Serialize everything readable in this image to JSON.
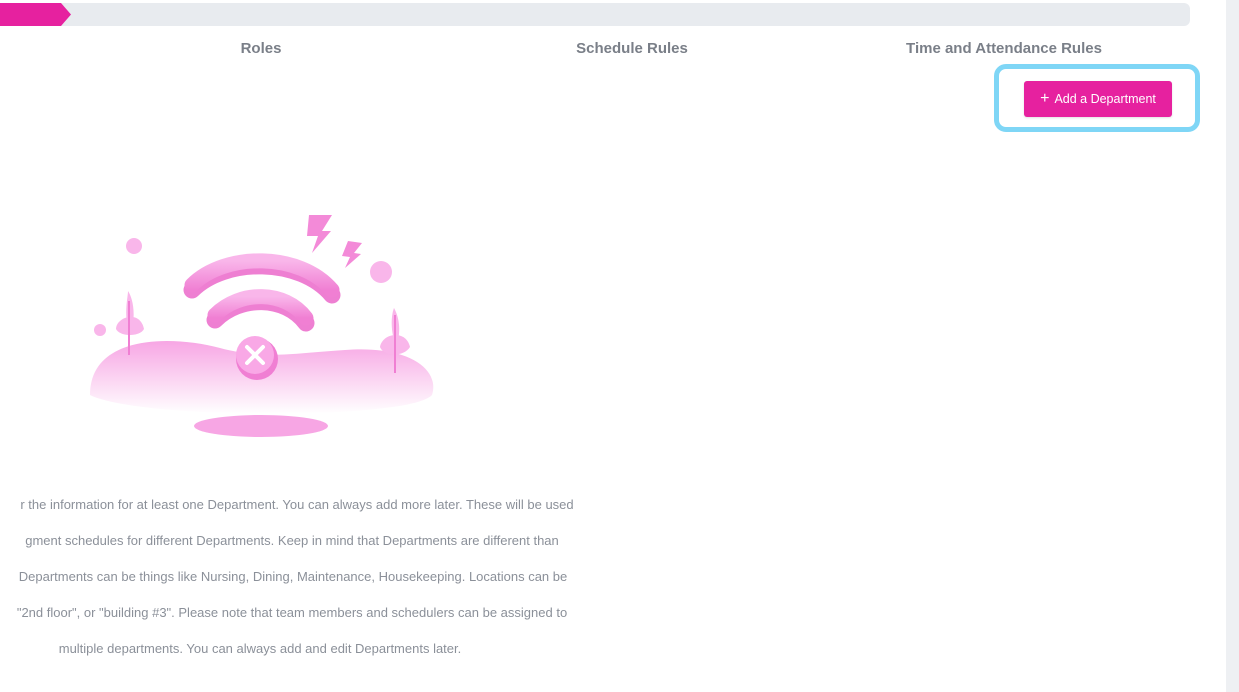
{
  "progress": {
    "completed_fraction": 0.06,
    "fill_color": "#e6219f",
    "track_color": "#e8ebef"
  },
  "steps": [
    {
      "label": "Roles"
    },
    {
      "label": "Schedule Rules"
    },
    {
      "label": "Time and Attendance Rules"
    }
  ],
  "actions": {
    "add_department_icon": "+",
    "add_department_label": "Add a Department"
  },
  "illustration": {
    "icon": "no-wifi-illustration",
    "accent_color": "#f38ad8"
  },
  "description": {
    "lines": [
      "r the information for at least one Department. You can always add more later. These will be used",
      "gment schedules for different Departments. Keep in mind that Departments are different than",
      " Departments can be things like Nursing, Dining, Maintenance, Housekeeping. Locations can be",
      " \"2nd floor\", or \"building #3\". Please note that team members and schedulers can be assigned to",
      "multiple departments. You can always add and edit Departments later."
    ]
  },
  "colors": {
    "brand": "#e6219f",
    "highlight": "#7fd6f6",
    "step_text": "#7a7f88",
    "body_text": "#8b9099"
  }
}
